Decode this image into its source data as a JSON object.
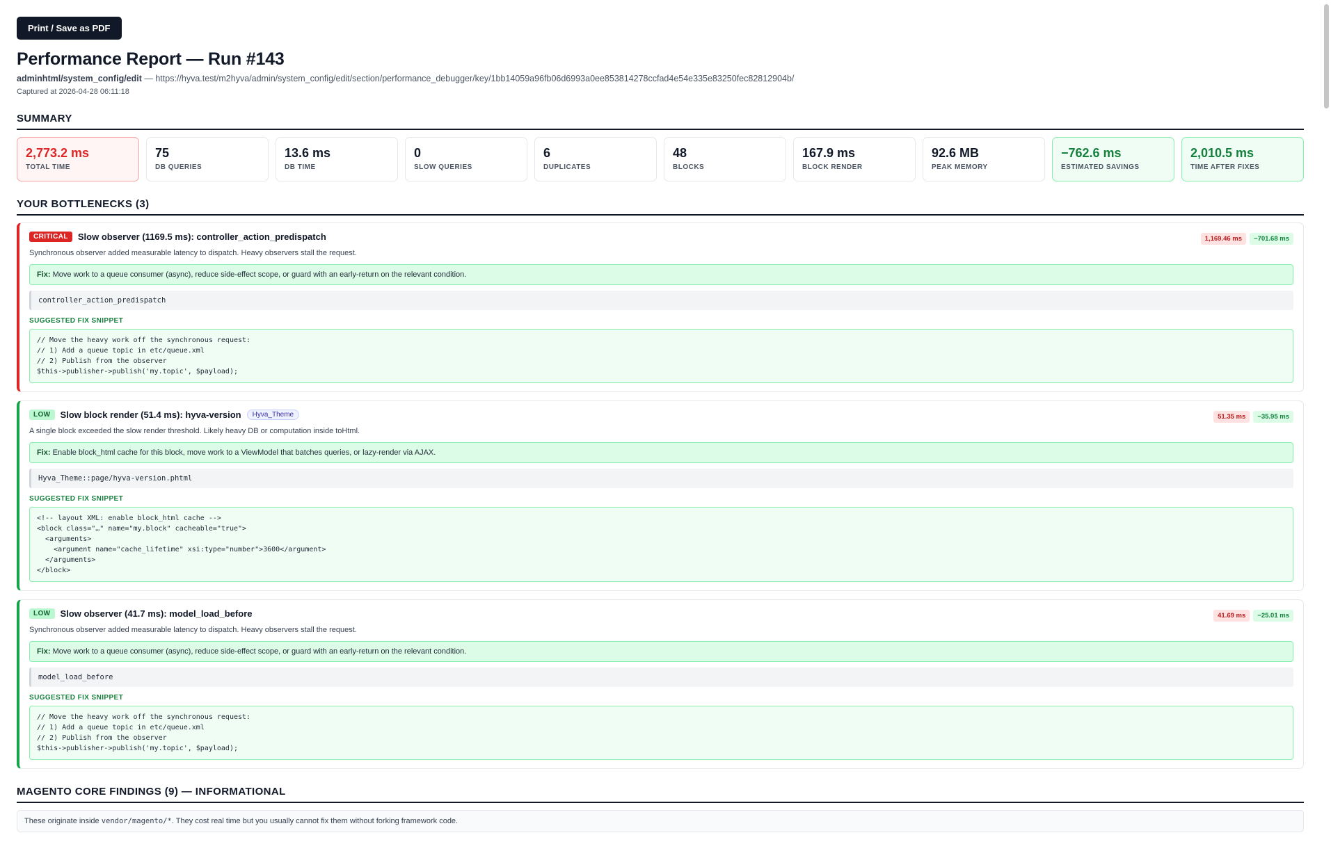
{
  "toolbar": {
    "print_label": "Print / Save as PDF"
  },
  "header": {
    "title": "Performance Report — Run #143",
    "route": "adminhtml/system_config/edit",
    "url_sep": " — ",
    "url": "https://hyva.test/m2hyva/admin/system_config/edit/section/performance_debugger/key/1bb14059a96fb06d6993a0ee853814278ccfad4e54e335e83250fec82812904b/",
    "captured": "Captured at 2026-04-28 06:11:18"
  },
  "summary": {
    "title": "SUMMARY",
    "kpis": [
      {
        "value": "2,773.2 ms",
        "label": "TOTAL TIME"
      },
      {
        "value": "75",
        "label": "DB QUERIES"
      },
      {
        "value": "13.6 ms",
        "label": "DB TIME"
      },
      {
        "value": "0",
        "label": "SLOW QUERIES"
      },
      {
        "value": "6",
        "label": "DUPLICATES"
      },
      {
        "value": "48",
        "label": "BLOCKS"
      },
      {
        "value": "167.9 ms",
        "label": "BLOCK RENDER"
      },
      {
        "value": "92.6 MB",
        "label": "PEAK MEMORY"
      },
      {
        "value": "−762.6 ms",
        "label": "ESTIMATED SAVINGS"
      },
      {
        "value": "2,010.5 ms",
        "label": "TIME AFTER FIXES"
      }
    ]
  },
  "bottlenecks": {
    "title": "YOUR BOTTLENECKS (3)",
    "items": [
      {
        "severity": "CRITICAL",
        "title": "Slow observer (1169.5 ms): controller_action_predispatch",
        "cost": "1,169.46 ms",
        "saving": "−701.68 ms",
        "description": "Synchronous observer added measurable latency to dispatch. Heavy observers stall the request.",
        "fix_label": "Fix:",
        "fix_text": " Move work to a queue consumer (async), reduce side-effect scope, or guard with an early-return on the relevant condition.",
        "code_ref": "controller_action_predispatch",
        "snippet_label": "SUGGESTED FIX SNIPPET",
        "snippet": "// Move the heavy work off the synchronous request:\n// 1) Add a queue topic in etc/queue.xml\n// 2) Publish from the observer\n$this->publisher->publish('my.topic', $payload);"
      },
      {
        "severity": "LOW",
        "title": "Slow block render (51.4 ms): hyva-version",
        "tag": "Hyva_Theme",
        "cost": "51.35 ms",
        "saving": "−35.95 ms",
        "description": "A single block exceeded the slow render threshold. Likely heavy DB or computation inside toHtml.",
        "fix_label": "Fix:",
        "fix_text": " Enable block_html cache for this block, move work to a ViewModel that batches queries, or lazy-render via AJAX.",
        "code_ref": "Hyva_Theme::page/hyva-version.phtml",
        "snippet_label": "SUGGESTED FIX SNIPPET",
        "snippet": "<!-- layout XML: enable block_html cache -->\n<block class=\"…\" name=\"my.block\" cacheable=\"true\">\n  <arguments>\n    <argument name=\"cache_lifetime\" xsi:type=\"number\">3600</argument>\n  </arguments>\n</block>"
      },
      {
        "severity": "LOW",
        "title": "Slow observer (41.7 ms): model_load_before",
        "cost": "41.69 ms",
        "saving": "−25.01 ms",
        "description": "Synchronous observer added measurable latency to dispatch. Heavy observers stall the request.",
        "fix_label": "Fix:",
        "fix_text": " Move work to a queue consumer (async), reduce side-effect scope, or guard with an early-return on the relevant condition.",
        "code_ref": "model_load_before",
        "snippet_label": "SUGGESTED FIX SNIPPET",
        "snippet": "// Move the heavy work off the synchronous request:\n// 1) Add a queue topic in etc/queue.xml\n// 2) Publish from the observer\n$this->publisher->publish('my.topic', $payload);"
      }
    ]
  },
  "core": {
    "title": "MAGENTO CORE FINDINGS (9) — INFORMATIONAL",
    "note_pre": "These originate inside ",
    "note_code": "vendor/magento/*",
    "note_post": ". They cost real time but you usually cannot fix them without forking framework code."
  }
}
